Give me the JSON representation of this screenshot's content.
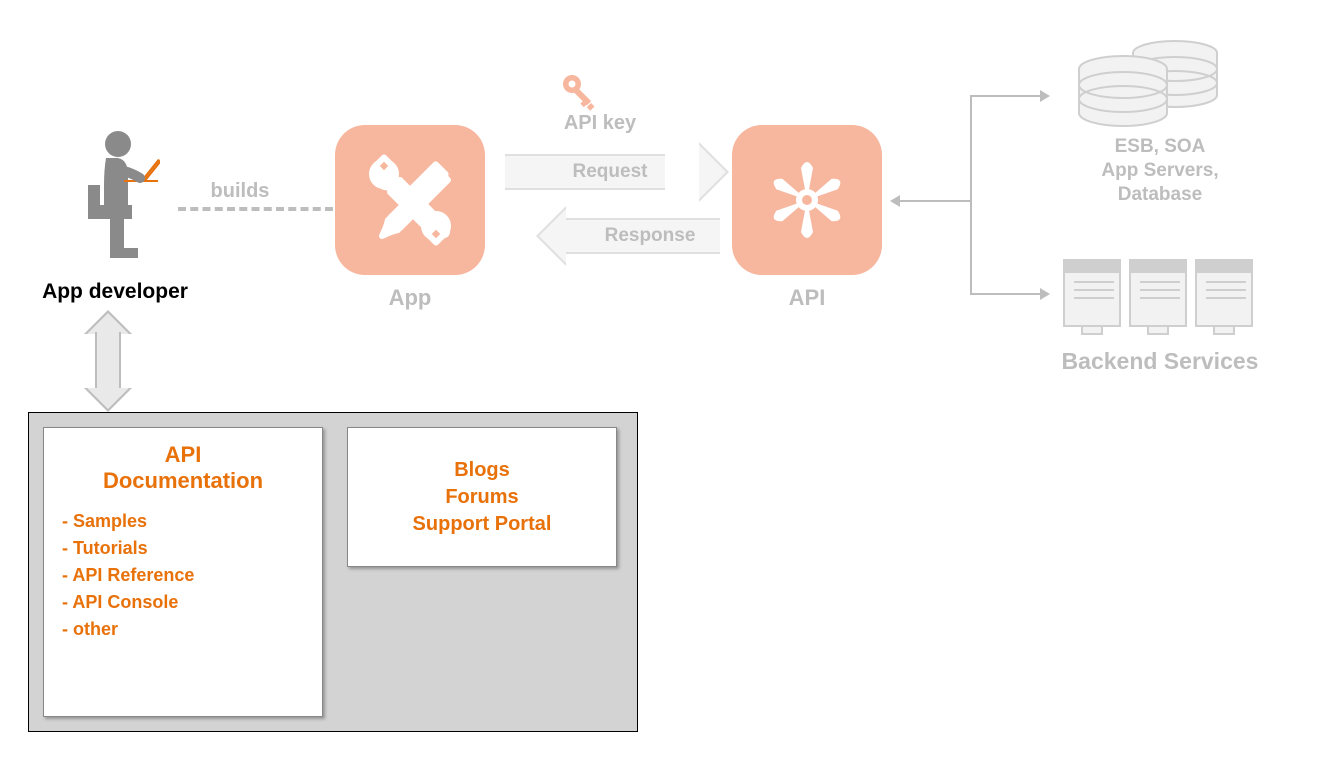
{
  "developer": {
    "label": "App developer"
  },
  "builds": {
    "label": "builds"
  },
  "app": {
    "label": "App"
  },
  "api": {
    "label": "API"
  },
  "flow": {
    "apiKey": "API key",
    "request": "Request",
    "response": "Response"
  },
  "backend": {
    "title": "Backend Services",
    "top": "ESB, SOA\nApp Servers,\nDatabase"
  },
  "docPanel": {
    "card1": {
      "title": "API\nDocumentation",
      "items": [
        "Samples",
        "Tutorials",
        "API Reference",
        "API Console",
        "other"
      ]
    },
    "card2": {
      "lines": [
        "Blogs",
        "Forums",
        "Support Portal"
      ]
    }
  }
}
